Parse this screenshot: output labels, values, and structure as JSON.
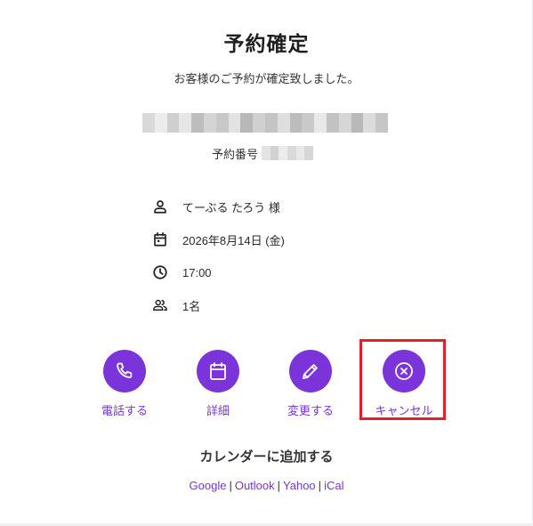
{
  "header": {
    "title": "予約確定",
    "subtitle": "お客様のご予約が確定致しました。"
  },
  "booking": {
    "number_label": "予約番号"
  },
  "details": [
    {
      "icon": "person-icon",
      "text": "てーぶる たろう 様"
    },
    {
      "icon": "calendar-icon",
      "text": "2026年8月14日 (金)"
    },
    {
      "icon": "clock-icon",
      "text": "17:00"
    },
    {
      "icon": "people-icon",
      "text": "1名"
    }
  ],
  "actions": [
    {
      "icon": "phone-icon",
      "label": "電話する"
    },
    {
      "icon": "calendar-icon",
      "label": "詳細"
    },
    {
      "icon": "pencil-icon",
      "label": "変更する"
    },
    {
      "icon": "cancel-circle-icon",
      "label": "キャンセル"
    }
  ],
  "calendar": {
    "heading": "カレンダーに追加する",
    "links": [
      "Google",
      "Outlook",
      "Yahoo",
      "iCal"
    ]
  },
  "colors": {
    "accent": "#7a34d9",
    "highlight": "#e0202d",
    "text": "#222222"
  }
}
